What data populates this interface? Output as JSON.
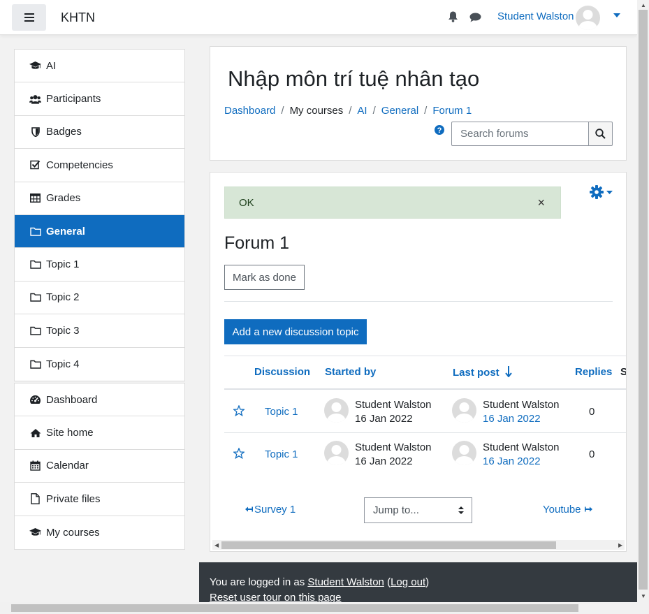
{
  "navbar": {
    "brand": "KHTN",
    "user_name": "Student Walston",
    "icons": [
      "menu-icon",
      "bell-icon",
      "chat-icon",
      "caret-down-icon"
    ]
  },
  "drawer": {
    "course_items": [
      {
        "label": "AI",
        "icon": "graduation-cap-icon",
        "active": false
      },
      {
        "label": "Participants",
        "icon": "users-icon",
        "active": false
      },
      {
        "label": "Badges",
        "icon": "shield-icon",
        "active": false
      },
      {
        "label": "Competencies",
        "icon": "check-square-icon",
        "active": false
      },
      {
        "label": "Grades",
        "icon": "table-icon",
        "active": false
      },
      {
        "label": "General",
        "icon": "folder-icon",
        "active": true
      },
      {
        "label": "Topic 1",
        "icon": "folder-icon",
        "active": false
      },
      {
        "label": "Topic 2",
        "icon": "folder-icon",
        "active": false
      },
      {
        "label": "Topic 3",
        "icon": "folder-icon",
        "active": false
      },
      {
        "label": "Topic 4",
        "icon": "folder-icon",
        "active": false
      }
    ],
    "site_items": [
      {
        "label": "Dashboard",
        "icon": "tachometer-icon"
      },
      {
        "label": "Site home",
        "icon": "home-icon"
      },
      {
        "label": "Calendar",
        "icon": "calendar-icon"
      },
      {
        "label": "Private files",
        "icon": "file-icon"
      },
      {
        "label": "My courses",
        "icon": "graduation-cap-icon"
      }
    ]
  },
  "header": {
    "course_title": "Nhập môn trí tuệ nhân tạo",
    "breadcrumb": [
      "Dashboard",
      "My courses",
      "AI",
      "General",
      "Forum 1"
    ],
    "search_placeholder": "Search forums"
  },
  "main": {
    "alert_text": "OK",
    "alert_close": "×",
    "forum_title": "Forum 1",
    "mark_done_label": "Mark as done",
    "add_topic_label": "Add a new discussion topic",
    "columns": {
      "discussion": "Discussion",
      "started_by": "Started by",
      "last_post": "Last post",
      "replies": "Replies",
      "cut": "S"
    },
    "rows": [
      {
        "topic": "Topic 1",
        "started_name": "Student Walston",
        "started_date": "16 Jan 2022",
        "last_name": "Student Walston",
        "last_date": "16 Jan 2022",
        "replies": "0"
      },
      {
        "topic": "Topic 1",
        "started_name": "Student Walston",
        "started_date": "16 Jan 2022",
        "last_name": "Student Walston",
        "last_date": "16 Jan 2022",
        "replies": "0"
      }
    ],
    "prev_link": "Survey 1",
    "jump_label": "Jump to...",
    "next_link": "Youtube"
  },
  "footer": {
    "logged_in_prefix": "You are logged in as ",
    "user_link": "Student Walston",
    "logout_open": " (",
    "logout_link": "Log out",
    "logout_close": ")",
    "reset_tour": "Reset user tour on this page"
  },
  "colors": {
    "primary": "#0f6cbf",
    "alert_bg": "#d7e6d6",
    "footer_bg": "#343a40"
  }
}
